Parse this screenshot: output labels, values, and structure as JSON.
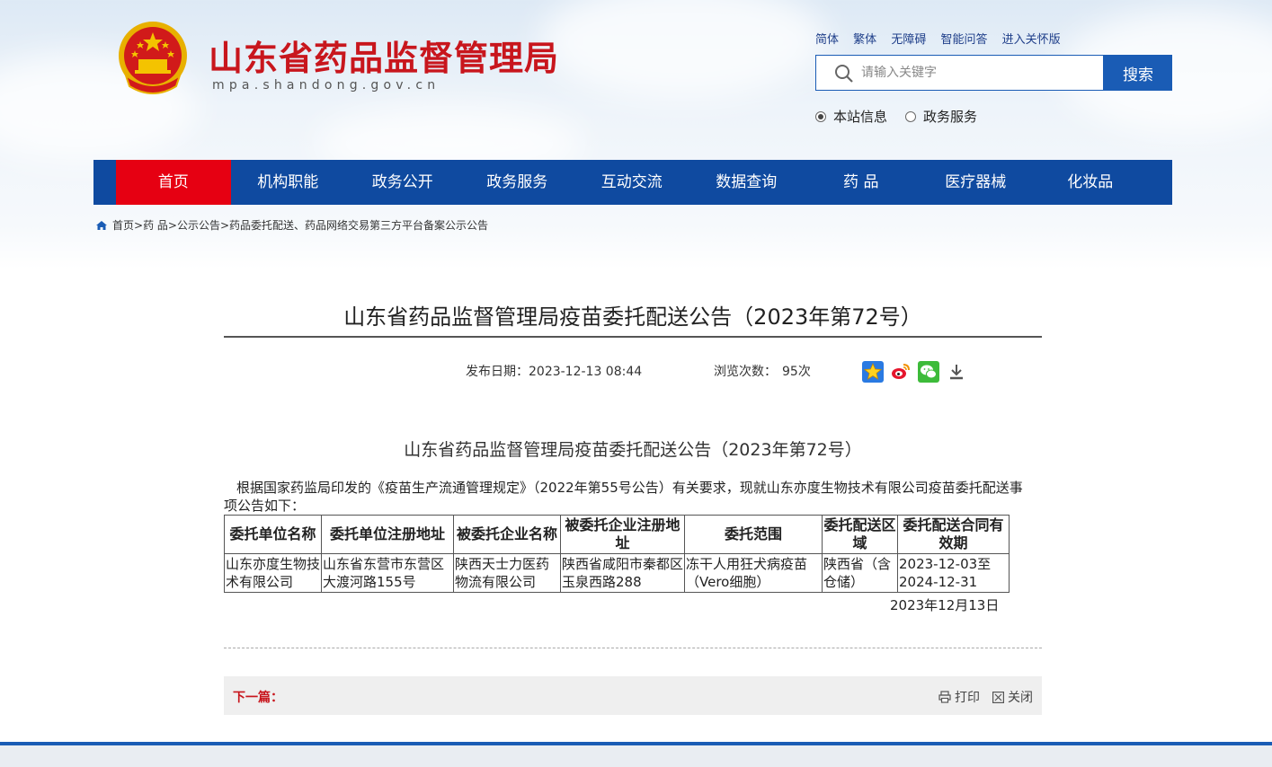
{
  "header": {
    "site_title": "山东省药品监督管理局",
    "site_domain": "mpa.shandong.gov.cn",
    "top_links": [
      "简体",
      "繁体",
      "无障碍",
      "智能问答",
      "进入关怀版"
    ],
    "search": {
      "placeholder": "请输入关键字",
      "button_label": "搜索"
    },
    "scope_options": [
      {
        "label": "本站信息",
        "selected": true
      },
      {
        "label": "政务服务",
        "selected": false
      }
    ],
    "brand_color": "#c8161d"
  },
  "nav": {
    "items": [
      "首页",
      "机构职能",
      "政务公开",
      "政务服务",
      "互动交流",
      "数据查询",
      "药 品",
      "医疗器械",
      "化妆品"
    ],
    "active_index": 0,
    "bar_color": "#0f4aa0",
    "active_color": "#e60012"
  },
  "breadcrumb": {
    "items": [
      "首页",
      "药 品",
      "公示公告",
      "药品委托配送、药品网络交易第三方平台备案公示公告"
    ],
    "separator": ">"
  },
  "article": {
    "title": "山东省药品监督管理局疫苗委托配送公告（2023年第72号）",
    "publish_date_label": "发布日期：",
    "publish_date": "2023-12-13 08:44",
    "views_label": "浏览次数：",
    "views": "95次",
    "share_icons": [
      "favorite-star-icon",
      "weibo-icon",
      "wechat-icon",
      "download-icon"
    ],
    "sub_title": "山东省药品监督管理局疫苗委托配送公告（2023年第72号）",
    "paragraph": "根据国家药监局印发的《疫苗生产流通管理规定》（2022年第55号公告）有关要求，现就山东亦度生物技术有限公司疫苗委托配送事项公告如下：",
    "table": {
      "headers": [
        "委托单位名称",
        "委托单位注册地址",
        "被委托企业名称",
        "被委托企业注册地址",
        "委托范围",
        "委托配送区域",
        "委托配送合同有效期"
      ],
      "rows": [
        [
          "山东亦度生物技术有限公司",
          "山东省东营市东营区大渡河路155号",
          "陕西天士力医药物流有限公司",
          "陕西省咸阳市秦都区玉泉西路288",
          "冻干人用狂犬病疫苗（Vero细胞）",
          "陕西省（含仓储）",
          "2023-12-03至2024-12-31"
        ]
      ]
    },
    "sign_date": "2023年12月13日"
  },
  "footer_bar": {
    "next_label": "下一篇：",
    "print_label": "打印",
    "close_label": "关闭"
  }
}
